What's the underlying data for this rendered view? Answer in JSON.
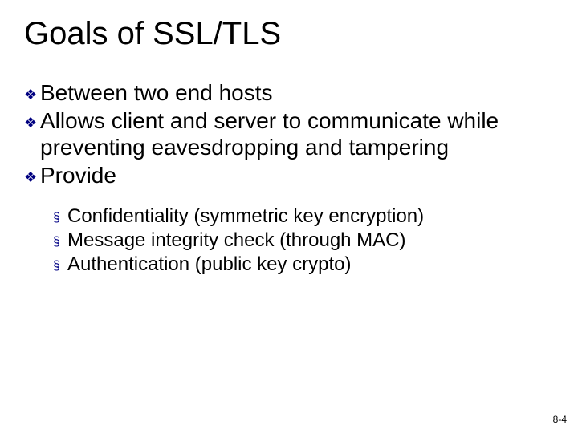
{
  "title": "Goals of SSL/TLS",
  "bullets": {
    "b1": "Between two end hosts",
    "b2": "Allows client and server to communicate while preventing eavesdropping and tampering",
    "b3": "Provide"
  },
  "sub": {
    "s1": "Confidentiality (symmetric key encryption)",
    "s2": "Message integrity check (through MAC)",
    "s3": "Authentication (public key crypto)"
  },
  "glyphs": {
    "diamond": "❖",
    "square": "§"
  },
  "page": "8-4"
}
